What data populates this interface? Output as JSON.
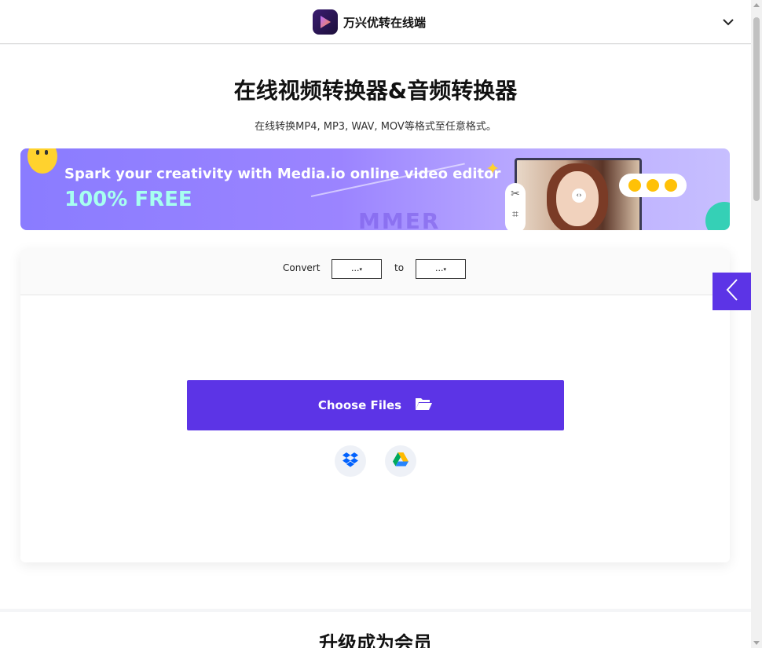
{
  "header": {
    "brand_name": "万兴优转在线端",
    "logo_icon": "wondershare-uniconverter-logo",
    "menu_icon": "chevron-down-icon"
  },
  "hero": {
    "title": "在线视频转换器&音频转换器",
    "subtitle": "在线转换MP4, MP3, WAV, MOV等格式至任意格式。"
  },
  "banner": {
    "headline": "Spark your creativity with Media.io online video editor",
    "tagline": "100% FREE",
    "deco_word": "MMER"
  },
  "converter": {
    "convert_label": "Convert",
    "from_value": "...",
    "to_label": "to",
    "to_value": "...",
    "choose_files_label": "Choose Files",
    "folder_icon": "folder-open-icon",
    "dropbox_icon": "dropbox-icon",
    "google_drive_icon": "google-drive-icon"
  },
  "side_tab": {
    "icon": "chevron-left-icon"
  },
  "membership": {
    "title": "升级成为会员"
  },
  "colors": {
    "accent": "#5c34e6",
    "banner_free_text": "#a7fff0"
  }
}
